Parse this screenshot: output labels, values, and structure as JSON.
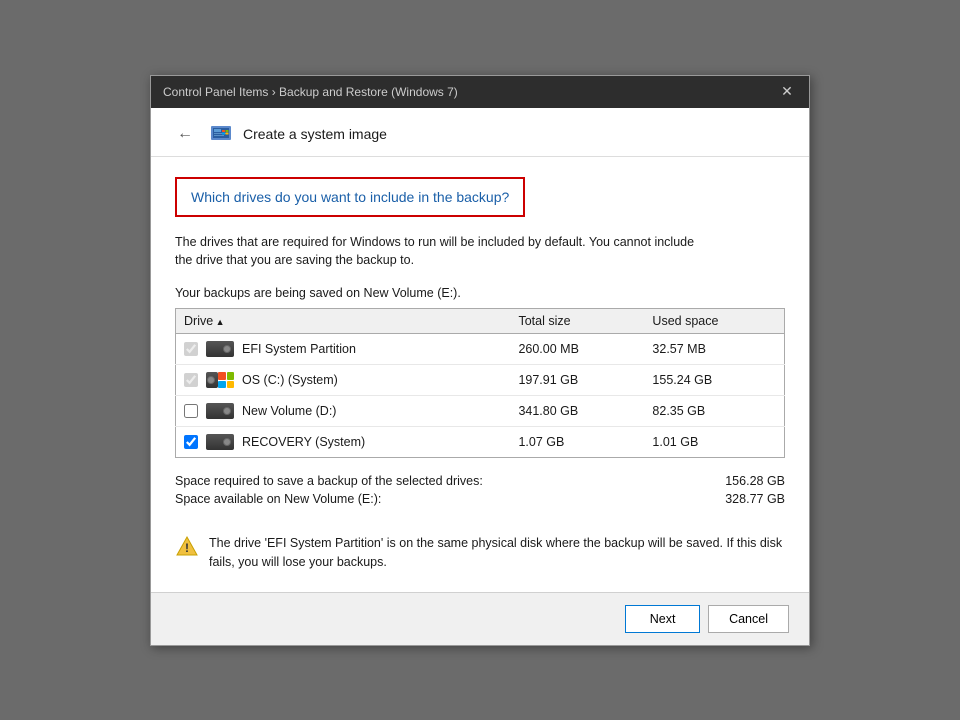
{
  "titleBar": {
    "text": "Control Panel Items › Backup and Restore (Windows 7)",
    "closeLabel": "✕"
  },
  "header": {
    "backLabel": "←",
    "iconAlt": "system-image-icon",
    "title": "Create a system image"
  },
  "main": {
    "questionText": "Which drives do you want to include in the backup?",
    "description1": "The drives that are required for Windows to run will be included by default. You cannot include",
    "description2": "the drive that you are saving the backup to.",
    "backupLocation": "Your backups are being saved on New Volume (E:).",
    "table": {
      "columns": [
        "Drive",
        "Total size",
        "Used space"
      ],
      "rows": [
        {
          "name": "EFI System Partition",
          "totalSize": "260.00 MB",
          "usedSpace": "32.57 MB",
          "checked": true,
          "disabled": true,
          "type": "hdd"
        },
        {
          "name": "OS (C:) (System)",
          "totalSize": "197.91 GB",
          "usedSpace": "155.24 GB",
          "checked": true,
          "disabled": true,
          "type": "windows"
        },
        {
          "name": "New Volume (D:)",
          "totalSize": "341.80 GB",
          "usedSpace": "82.35 GB",
          "checked": false,
          "disabled": false,
          "type": "hdd"
        },
        {
          "name": "RECOVERY (System)",
          "totalSize": "1.07 GB",
          "usedSpace": "1.01 GB",
          "checked": true,
          "disabled": false,
          "type": "hdd"
        }
      ]
    },
    "spaceRequired": {
      "label": "Space required to save a backup of the selected drives:",
      "value": "156.28 GB"
    },
    "spaceAvailable": {
      "label": "Space available on New Volume (E:):",
      "value": "328.77 GB"
    },
    "warning": "The drive 'EFI System Partition' is on the same physical disk where the backup will be saved. If this disk fails, you will lose your backups."
  },
  "footer": {
    "nextLabel": "Next",
    "cancelLabel": "Cancel"
  }
}
